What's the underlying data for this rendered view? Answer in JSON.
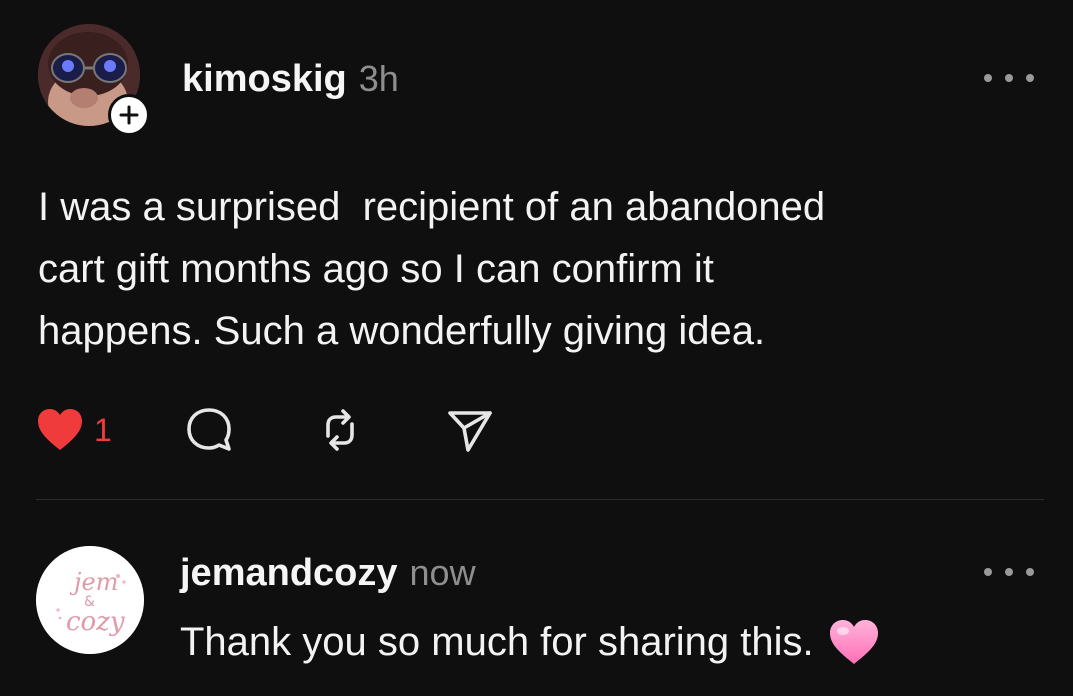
{
  "post": {
    "username": "kimoskig",
    "timestamp": "3h",
    "body": "I was a surprised  recipient of an abandoned\ncart gift months ago so I can confirm it\nhappens. Such a wonderfully giving idea.",
    "like_count": "1",
    "liked": true,
    "icons": {
      "follow": "plus-icon",
      "more": "more-options-icon",
      "like": "heart-icon",
      "reply": "comment-bubble-icon",
      "repost": "repost-icon",
      "share": "send-icon"
    }
  },
  "reply": {
    "username": "jemandcozy",
    "timestamp": "now",
    "body": "Thank you so much for sharing this.",
    "emoji": "pink-heart",
    "avatar_text": "jem & cozy"
  },
  "colors": {
    "background": "#0f0f0f",
    "like_red": "#ef3b3b",
    "muted_text": "#8e8e8e",
    "divider": "#2c2c2c",
    "heart_emoji_pink": "#ff8fc7"
  }
}
